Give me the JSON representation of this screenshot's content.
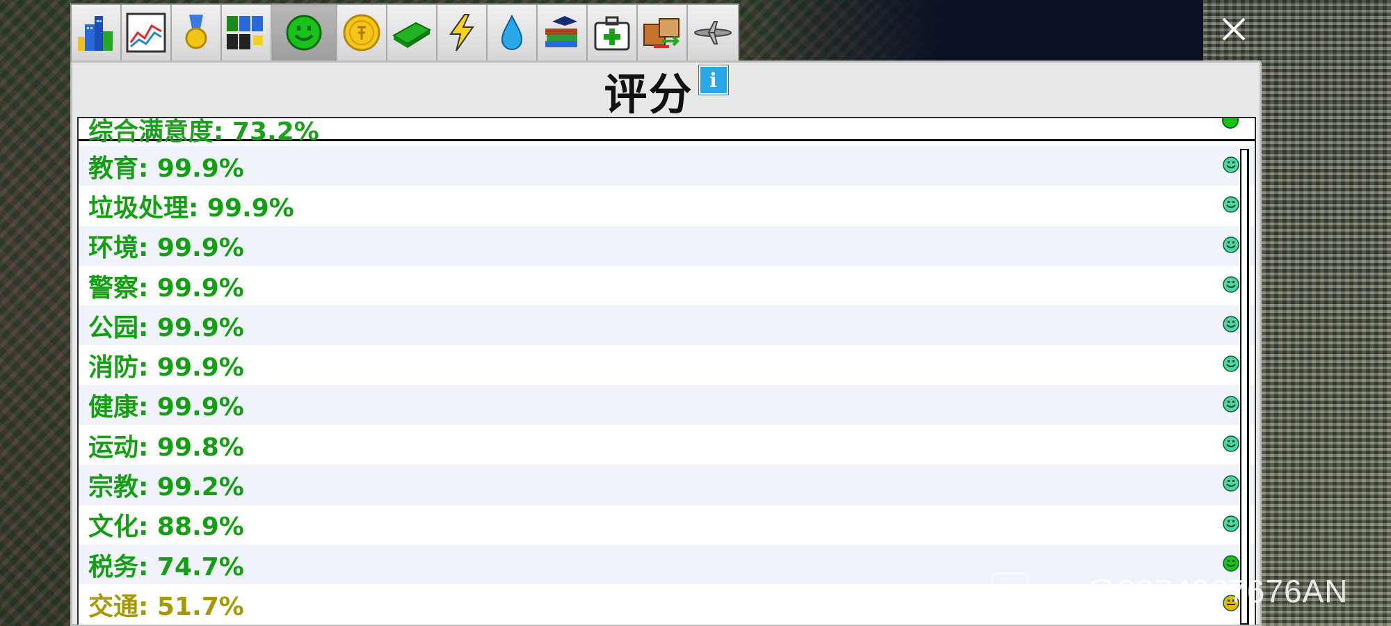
{
  "window": {
    "title": "评分",
    "info_icon_glyph": "i",
    "close_glyph": "✕"
  },
  "toolbar": {
    "tabs": [
      {
        "icon": "city-buildings-icon",
        "active": false
      },
      {
        "icon": "line-graph-icon",
        "active": false
      },
      {
        "icon": "medal-icon",
        "active": false
      },
      {
        "icon": "zoning-blocks-icon",
        "active": false
      },
      {
        "icon": "smiley-rating-icon",
        "active": true
      },
      {
        "icon": "coin-icon",
        "active": false
      },
      {
        "icon": "money-bill-icon",
        "active": false
      },
      {
        "icon": "lightning-icon",
        "active": false
      },
      {
        "icon": "water-drop-icon",
        "active": false
      },
      {
        "icon": "books-education-icon",
        "active": false
      },
      {
        "icon": "medical-kit-icon",
        "active": false
      },
      {
        "icon": "trade-boxes-icon",
        "active": false
      },
      {
        "icon": "airplane-icon",
        "active": false
      }
    ]
  },
  "summary": {
    "label": "综合满意度: 73.2%",
    "face": "green"
  },
  "ratings": [
    {
      "label": "教育: 99.9%",
      "face": "mint",
      "color": "green"
    },
    {
      "label": "垃圾处理: 99.9%",
      "face": "mint",
      "color": "green"
    },
    {
      "label": "环境: 99.9%",
      "face": "mint",
      "color": "green"
    },
    {
      "label": "警察: 99.9%",
      "face": "mint",
      "color": "green"
    },
    {
      "label": "公园: 99.9%",
      "face": "mint",
      "color": "green"
    },
    {
      "label": "消防: 99.9%",
      "face": "mint",
      "color": "green"
    },
    {
      "label": "健康: 99.9%",
      "face": "mint",
      "color": "green"
    },
    {
      "label": "运动: 99.8%",
      "face": "mint",
      "color": "green"
    },
    {
      "label": "宗教: 99.2%",
      "face": "mint",
      "color": "green"
    },
    {
      "label": "文化: 88.9%",
      "face": "mint",
      "color": "green"
    },
    {
      "label": "税务: 74.7%",
      "face": "green",
      "color": "green"
    },
    {
      "label": "交通: 51.7%",
      "face": "yellow",
      "color": "yellow"
    }
  ],
  "colors": {
    "green_text": "#12a012",
    "yellow_text": "#a79a00",
    "mint_face": "#4fd6a0",
    "green_face": "#17c21a",
    "yellow_face": "#e6b800",
    "info_blue": "#2aa7e6"
  },
  "watermark": {
    "text": "@23742?7676AN"
  }
}
